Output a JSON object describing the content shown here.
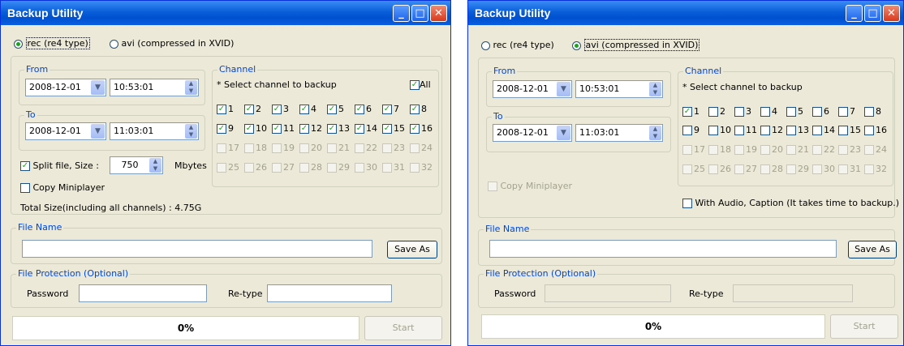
{
  "windows": [
    {
      "title": "Backup Utility",
      "format_rec": "rec (re4 type)",
      "format_avi": "avi (compressed in XVID)",
      "from_label": "From",
      "from_date": "2008-12-01",
      "from_time": "10:53:01",
      "to_label": "To",
      "to_date": "2008-12-01",
      "to_time": "11:03:01",
      "channel_label": "Channel",
      "channel_hint": "* Select channel to backup",
      "all_label": "All",
      "channels": [
        "1",
        "2",
        "3",
        "4",
        "5",
        "6",
        "7",
        "8",
        "9",
        "10",
        "11",
        "12",
        "13",
        "14",
        "15",
        "16",
        "17",
        "18",
        "19",
        "20",
        "21",
        "22",
        "23",
        "24",
        "25",
        "26",
        "27",
        "28",
        "29",
        "30",
        "31",
        "32"
      ],
      "split_label": "Split file, Size :",
      "split_size": "750",
      "split_unit": "Mbytes",
      "copy_miniplayer": "Copy Miniplayer",
      "total_size": "Total Size(including all channels) : 4.75G",
      "file_name_label": "File Name",
      "file_name_value": "",
      "save_as": "Save As",
      "protection_label": "File Protection (Optional)",
      "password_label": "Password",
      "retype_label": "Re-type",
      "progress": "0%",
      "start": "Start"
    },
    {
      "title": "Backup Utility",
      "format_rec": "rec (re4 type)",
      "format_avi": "avi (compressed in XVID)",
      "from_label": "From",
      "from_date": "2008-12-01",
      "from_time": "10:53:01",
      "to_label": "To",
      "to_date": "2008-12-01",
      "to_time": "11:03:01",
      "channel_label": "Channel",
      "channel_hint": "* Select channel to backup",
      "channels": [
        "1",
        "2",
        "3",
        "4",
        "5",
        "6",
        "7",
        "8",
        "9",
        "10",
        "11",
        "12",
        "13",
        "14",
        "15",
        "16",
        "17",
        "18",
        "19",
        "20",
        "21",
        "22",
        "23",
        "24",
        "25",
        "26",
        "27",
        "28",
        "29",
        "30",
        "31",
        "32"
      ],
      "copy_miniplayer": "Copy Miniplayer",
      "audio_caption": "With Audio, Caption (It takes time to backup.)",
      "file_name_label": "File Name",
      "file_name_value": "",
      "save_as": "Save As",
      "protection_label": "File Protection (Optional)",
      "password_label": "Password",
      "retype_label": "Re-type",
      "progress": "0%",
      "start": "Start"
    }
  ]
}
